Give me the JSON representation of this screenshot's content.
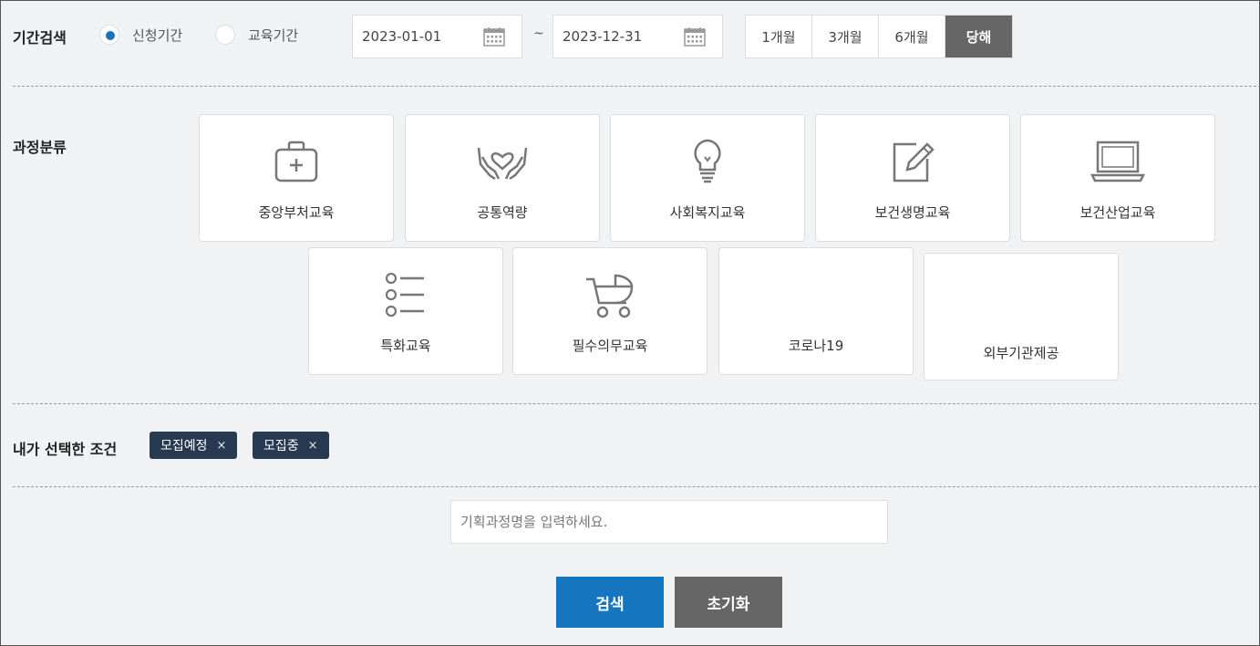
{
  "period": {
    "label": "기간검색",
    "radios": [
      {
        "label": "신청기간",
        "selected": true
      },
      {
        "label": "교육기간",
        "selected": false
      }
    ],
    "start_date": "2023-01-01",
    "separator": "~",
    "end_date": "2023-12-31",
    "quick": [
      "1개월",
      "3개월",
      "6개월",
      "당해"
    ],
    "quick_active": "당해"
  },
  "category": {
    "label": "과정분류",
    "items": [
      {
        "label": "중앙부처교육",
        "icon": "medical-kit-icon"
      },
      {
        "label": "공통역량",
        "icon": "heart-hands-icon"
      },
      {
        "label": "사회복지교육",
        "icon": "lightbulb-icon"
      },
      {
        "label": "보건생명교육",
        "icon": "edit-note-icon"
      },
      {
        "label": "보건산업교육",
        "icon": "laptop-icon"
      },
      {
        "label": "특화교육",
        "icon": "list-icon"
      },
      {
        "label": "필수의무교육",
        "icon": "stroller-icon"
      },
      {
        "label": "코로나19",
        "icon": ""
      },
      {
        "label": "외부기관제공",
        "icon": ""
      }
    ]
  },
  "selected_conditions": {
    "label": "내가 선택한 조건",
    "tags": [
      "모집예정",
      "모집중"
    ],
    "remove_glyph": "×"
  },
  "search": {
    "placeholder": "기획과정명을 입력하세요.",
    "value": ""
  },
  "buttons": {
    "search": "검색",
    "reset": "초기화"
  },
  "colors": {
    "accent": "#1575be",
    "tag_bg": "#283a52",
    "active_seg": "#666666",
    "background": "#f1f2f4"
  }
}
